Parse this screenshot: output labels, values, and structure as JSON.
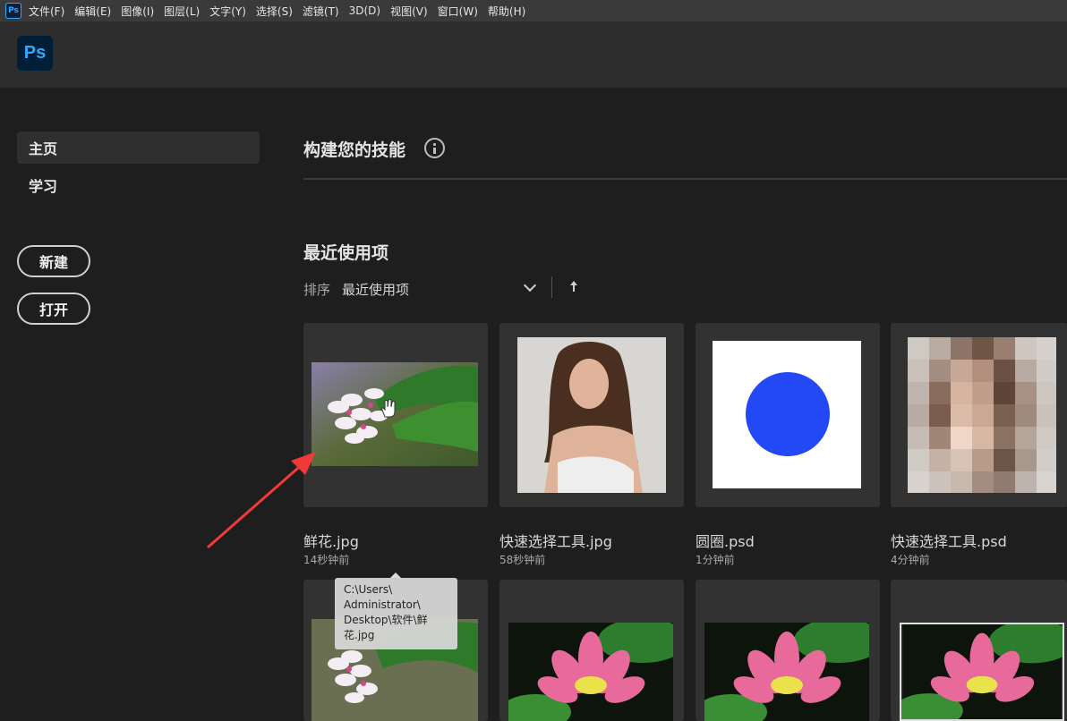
{
  "app": {
    "logo_text": "Ps",
    "accent": "#31a8ff"
  },
  "menubar": {
    "items": [
      "文件(F)",
      "编辑(E)",
      "图像(I)",
      "图层(L)",
      "文字(Y)",
      "选择(S)",
      "滤镜(T)",
      "3D(D)",
      "视图(V)",
      "窗口(W)",
      "帮助(H)"
    ]
  },
  "sidebar": {
    "nav": [
      {
        "label": "主页",
        "active": true
      },
      {
        "label": "学习",
        "active": false
      }
    ],
    "buttons": {
      "new_label": "新建",
      "open_label": "打开"
    }
  },
  "main": {
    "skills_title": "构建您的技能",
    "recent_title": "最近使用项",
    "sort": {
      "label": "排序",
      "value": "最近使用项"
    },
    "recent_files": [
      {
        "name": "鲜花.jpg",
        "time": "14秒钟前",
        "thumb": "plumeria-flowers"
      },
      {
        "name": "快速选择工具.jpg",
        "time": "58秒钟前",
        "thumb": "portrait-woman"
      },
      {
        "name": "圆圈.psd",
        "time": "1分钟前",
        "thumb": "blue-circle"
      },
      {
        "name": "快速选择工具.psd",
        "time": "4分钟前",
        "thumb": "pixelated-portrait"
      },
      {
        "thumb": "plumeria-flowers"
      },
      {
        "thumb": "lotus-flower"
      },
      {
        "thumb": "lotus-flower"
      },
      {
        "thumb": "lotus-flower"
      }
    ],
    "tooltip": "C:\\Users\\\nAdministrator\\\nDesktop\\软件\\鲜\n花.jpg"
  },
  "colors": {
    "circle": "#2249f5",
    "annotation_arrow": "#f03a3a"
  }
}
